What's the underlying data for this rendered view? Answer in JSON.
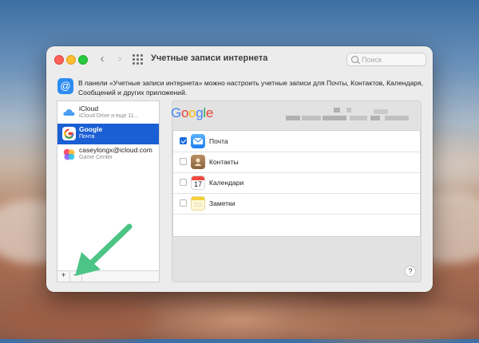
{
  "window": {
    "title": "Учетные записи интернета",
    "search_placeholder": "Поиск",
    "description": "В панели «Учетные записи интернета» можно настроить учетные записи для Почты, Контактов, Календаря, Сообщений и других приложений."
  },
  "accounts": [
    {
      "name": "iCloud",
      "sub": "iCloud Drive и еще 11...",
      "icon": "icloud-icon",
      "selected": false
    },
    {
      "name": "Google",
      "sub": "Почта",
      "icon": "google-icon",
      "selected": true
    },
    {
      "name": "caseylongx@icloud.com",
      "sub": "Game Center",
      "icon": "game-center-icon",
      "selected": false
    }
  ],
  "sidebar_buttons": {
    "add": "+",
    "remove": "−"
  },
  "detail": {
    "provider_logo": "Google",
    "services": [
      {
        "label": "Почта",
        "checked": true,
        "icon": "mail-icon"
      },
      {
        "label": "Контакты",
        "checked": false,
        "icon": "contacts-icon"
      },
      {
        "label": "Календари",
        "checked": false,
        "icon": "calendar-icon"
      },
      {
        "label": "Заметки",
        "checked": false,
        "icon": "notes-icon"
      }
    ],
    "calendar_day": "17",
    "help": "?"
  },
  "colors": {
    "accent": "#1a5fd4",
    "annotation_arrow": "#4cc486"
  }
}
